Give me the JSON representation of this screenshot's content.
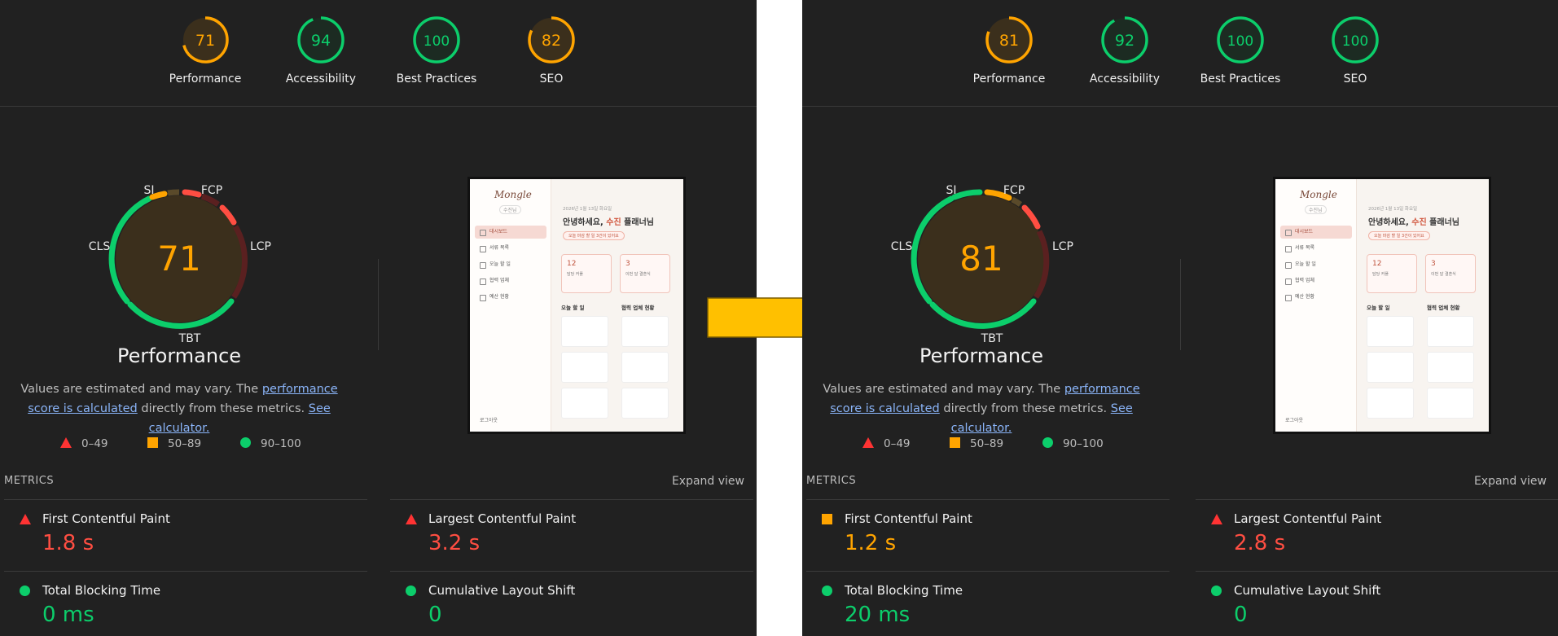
{
  "left": {
    "gauges": [
      {
        "label": "Performance",
        "score": "71",
        "status": "average"
      },
      {
        "label": "Accessibility",
        "score": "94",
        "status": "pass"
      },
      {
        "label": "Best Practices",
        "score": "100",
        "status": "pass"
      },
      {
        "label": "SEO",
        "score": "82",
        "status": "average"
      }
    ],
    "big_score": "71",
    "metrics": [
      {
        "name": "First Contentful Paint",
        "value": "1.8 s",
        "status": "fail"
      },
      {
        "name": "Largest Contentful Paint",
        "value": "3.2 s",
        "status": "fail"
      },
      {
        "name": "Total Blocking Time",
        "value": "0 ms",
        "status": "pass"
      },
      {
        "name": "Cumulative Layout Shift",
        "value": "0",
        "status": "pass"
      }
    ]
  },
  "right": {
    "gauges": [
      {
        "label": "Performance",
        "score": "81",
        "status": "average"
      },
      {
        "label": "Accessibility",
        "score": "92",
        "status": "pass"
      },
      {
        "label": "Best Practices",
        "score": "100",
        "status": "pass"
      },
      {
        "label": "SEO",
        "score": "100",
        "status": "pass"
      }
    ],
    "big_score": "81",
    "metrics": [
      {
        "name": "First Contentful Paint",
        "value": "1.2 s",
        "status": "average"
      },
      {
        "name": "Largest Contentful Paint",
        "value": "2.8 s",
        "status": "fail"
      },
      {
        "name": "Total Blocking Time",
        "value": "20 ms",
        "status": "pass"
      },
      {
        "name": "Cumulative Layout Shift",
        "value": "0",
        "status": "pass"
      }
    ]
  },
  "common": {
    "perf_title": "Performance",
    "desc_prefix": "Values are estimated and may vary. The ",
    "desc_link1": "performance score is calculated",
    "desc_middle": " directly from these metrics. ",
    "desc_link2": "See calculator.",
    "legend": {
      "fail": "0–49",
      "average": "50–89",
      "pass": "90–100"
    },
    "metrics_heading": "METRICS",
    "expand_view": "Expand view",
    "segment_labels": {
      "si": "SI",
      "fcp": "FCP",
      "lcp": "LCP",
      "tbt": "TBT",
      "cls": "CLS"
    }
  },
  "thumbnail": {
    "logo": "Mongle",
    "logo_sub": "수진님",
    "nav": [
      "대시보드",
      "서류 목록",
      "오늘 할 일",
      "협력 업체",
      "예산 현황"
    ],
    "logout": "로그아웃",
    "date": "2026년 1월 13일 화요일",
    "greeting_prefix": "안녕하세요, ",
    "greeting_name": "수진",
    "greeting_suffix": " 플래너님",
    "pill": "오늘 마감 할 일 3건이 있어요",
    "card1_num": "12",
    "card1_label": "담당 커플",
    "card2_num": "3",
    "card2_label": "이번 달 결혼식",
    "sec1": "오늘 할 일",
    "sec2": "협력 업체 현황"
  },
  "colors": {
    "pass": "#0cce6b",
    "average": "#ffa400",
    "fail": "#ff4e42",
    "arrow": "#ffc000",
    "panel_bg": "#212121"
  }
}
